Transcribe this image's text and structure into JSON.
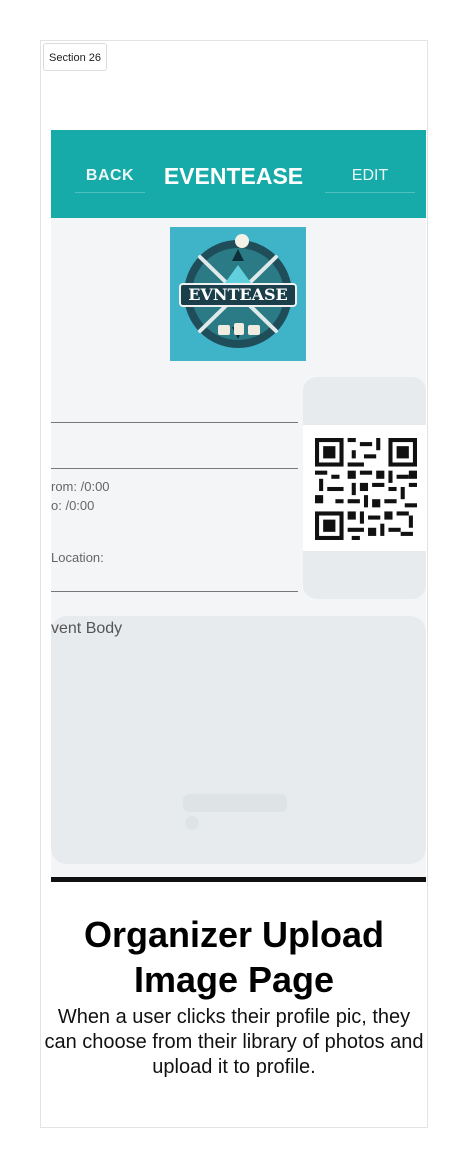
{
  "section": {
    "tag": "Section 26"
  },
  "app": {
    "appbar": {
      "back_label": "BACK",
      "title": "EVENTEASE",
      "edit_label": "EDIT"
    },
    "logo": {
      "text": "EVNTEASE"
    },
    "form": {
      "from_text": "rom: /0:00",
      "to_text": "o:     /0:00",
      "location_label": "Location:",
      "body_label": "vent Body"
    }
  },
  "caption": {
    "title": "Organizer Upload Image Page",
    "description": "When a user clicks their profile pic, they can choose from their library of photos and upload it to profile."
  }
}
